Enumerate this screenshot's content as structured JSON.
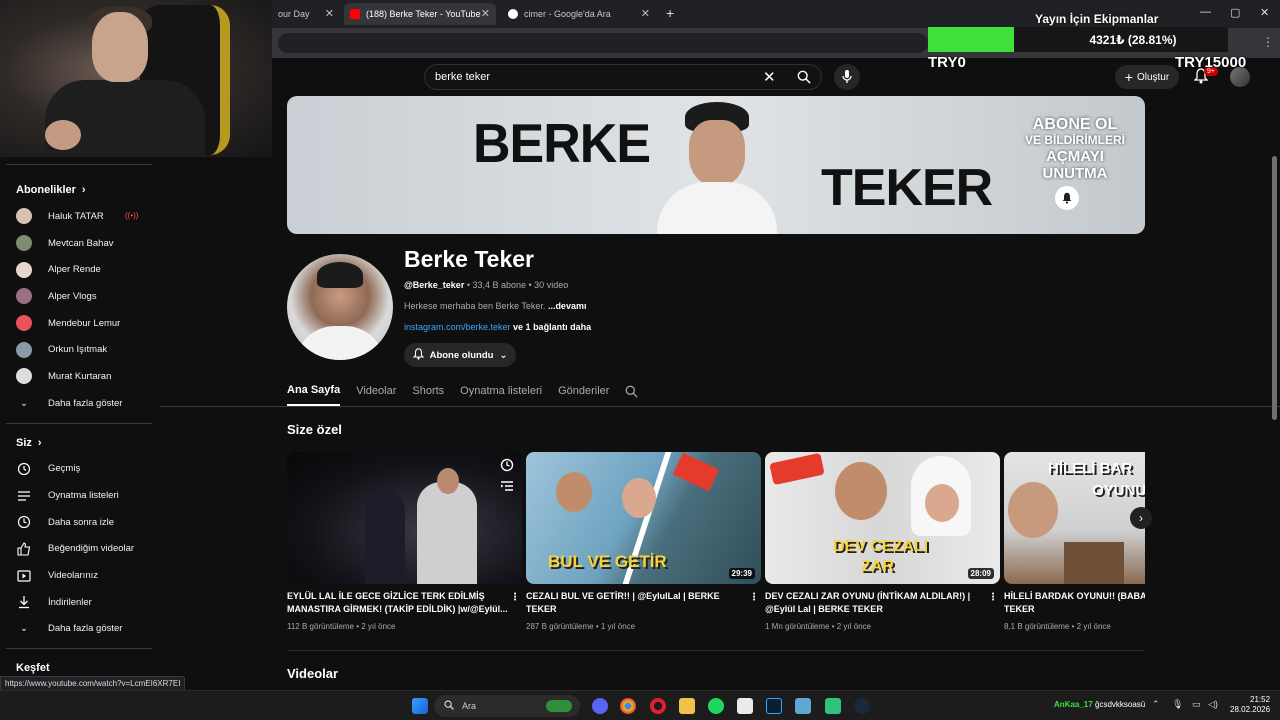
{
  "browser": {
    "tabs": [
      {
        "label": "our Day"
      },
      {
        "label": "(188) Berke Teker - YouTube",
        "active": true
      },
      {
        "label": "cimer - Google'da Ara"
      }
    ],
    "new_tab": "+",
    "window_controls": [
      "—",
      "▢",
      "✕"
    ]
  },
  "donation": {
    "title": "Yayın İçin Ekipmanlar",
    "value": "4321₺ (28.81%)",
    "progress_fraction": 0.2881,
    "min": "TRY0",
    "max": "TRY15000",
    "color": "#3ee03a"
  },
  "masthead": {
    "search_value": "berke teker",
    "create_label": "Oluştur",
    "notif_badge": "9+"
  },
  "sidebar": {
    "subscriptions_title": "Abonelikler",
    "subscriptions": [
      {
        "label": "Haluk TATAR",
        "live": true
      },
      {
        "label": "Mevtcan Bahav"
      },
      {
        "label": "Alper Rende"
      },
      {
        "label": "Alper Vlogs"
      },
      {
        "label": "Mendebur Lemur"
      },
      {
        "label": "Orkun Işıtmak"
      },
      {
        "label": "Murat Kurtaran"
      },
      {
        "label": "Daha fazla göster"
      }
    ],
    "you_title": "Siz",
    "you_items": [
      {
        "label": "Geçmiş",
        "icon": "history-icon"
      },
      {
        "label": "Oynatma listeleri",
        "icon": "playlist-icon"
      },
      {
        "label": "Daha sonra izle",
        "icon": "clock-icon"
      },
      {
        "label": "Beğendiğim videolar",
        "icon": "thumbs-up-icon"
      },
      {
        "label": "Videolarınız",
        "icon": "video-icon"
      },
      {
        "label": "İndirilenler",
        "icon": "download-icon"
      },
      {
        "label": "Daha fazla göster",
        "icon": "chevron-down-icon"
      }
    ],
    "explore_title": "Keşfet"
  },
  "banner": {
    "word1": "BERKE",
    "word2": "TEKER",
    "line1": "ABONE OL",
    "line2": "VE BİLDİRİMLERİ",
    "line3": "AÇMAYI UNUTMA"
  },
  "channel": {
    "name": "Berke Teker",
    "handle": "@Berke_teker",
    "stats": " • 33,4 B abone • 30 video",
    "description": "Herkese merhaba ben Berke Teker.",
    "more": "...devamı",
    "link": "instagram.com/berke.teker",
    "link_more": " ve 1 bağlantı daha",
    "subscribe_label": "Abone olundu"
  },
  "tabs": [
    "Ana Sayfa",
    "Videolar",
    "Shorts",
    "Oynatma listeleri",
    "Gönderiler"
  ],
  "section_title": "Size özel",
  "videos": [
    {
      "title": "EYLÜL LAL İLE GECE GİZLİCE TERK EDİLMİŞ MANASTIRA GİRMEK! (TAKİP EDİLDİK) |w/@Eylül...",
      "meta": "112 B görüntüleme • 2 yıl önce",
      "duration": ""
    },
    {
      "title": "CEZALI BUL VE GETİR!! | @EylulLal | BERKE TEKER",
      "meta": "287 B görüntüleme • 1 yıl önce",
      "duration": "29:39",
      "thumb_text": "BUL VE GETİR"
    },
    {
      "title": "DEV CEZALI ZAR OYUNU (İNTİKAM ALDILAR!) | @Eylül Lal | BERKE TEKER",
      "meta": "1 Mn görüntüleme • 2 yıl önce",
      "duration": "28:09",
      "thumb_text1": "DEV CEZALI",
      "thumb_text2": "ZAR"
    },
    {
      "title": "HİLELİ BARDAK OYUNU!! (BABAM... BERKE TEKER",
      "meta": "8,1 B görüntüleme • 2 yıl önce",
      "duration": "",
      "thumb_text1": "HİLELİ BAR",
      "thumb_text2": "OYUNU"
    }
  ],
  "section_title2": "Videolar",
  "status_url": "https://www.youtube.com/watch?v=LcmEI6XR7EI",
  "taskbar": {
    "search_placeholder": "Ara",
    "user1": "AnKaa_17",
    "user2": "ğcsdvkksoasü",
    "time": "21:52",
    "date": "28.02.2026"
  }
}
